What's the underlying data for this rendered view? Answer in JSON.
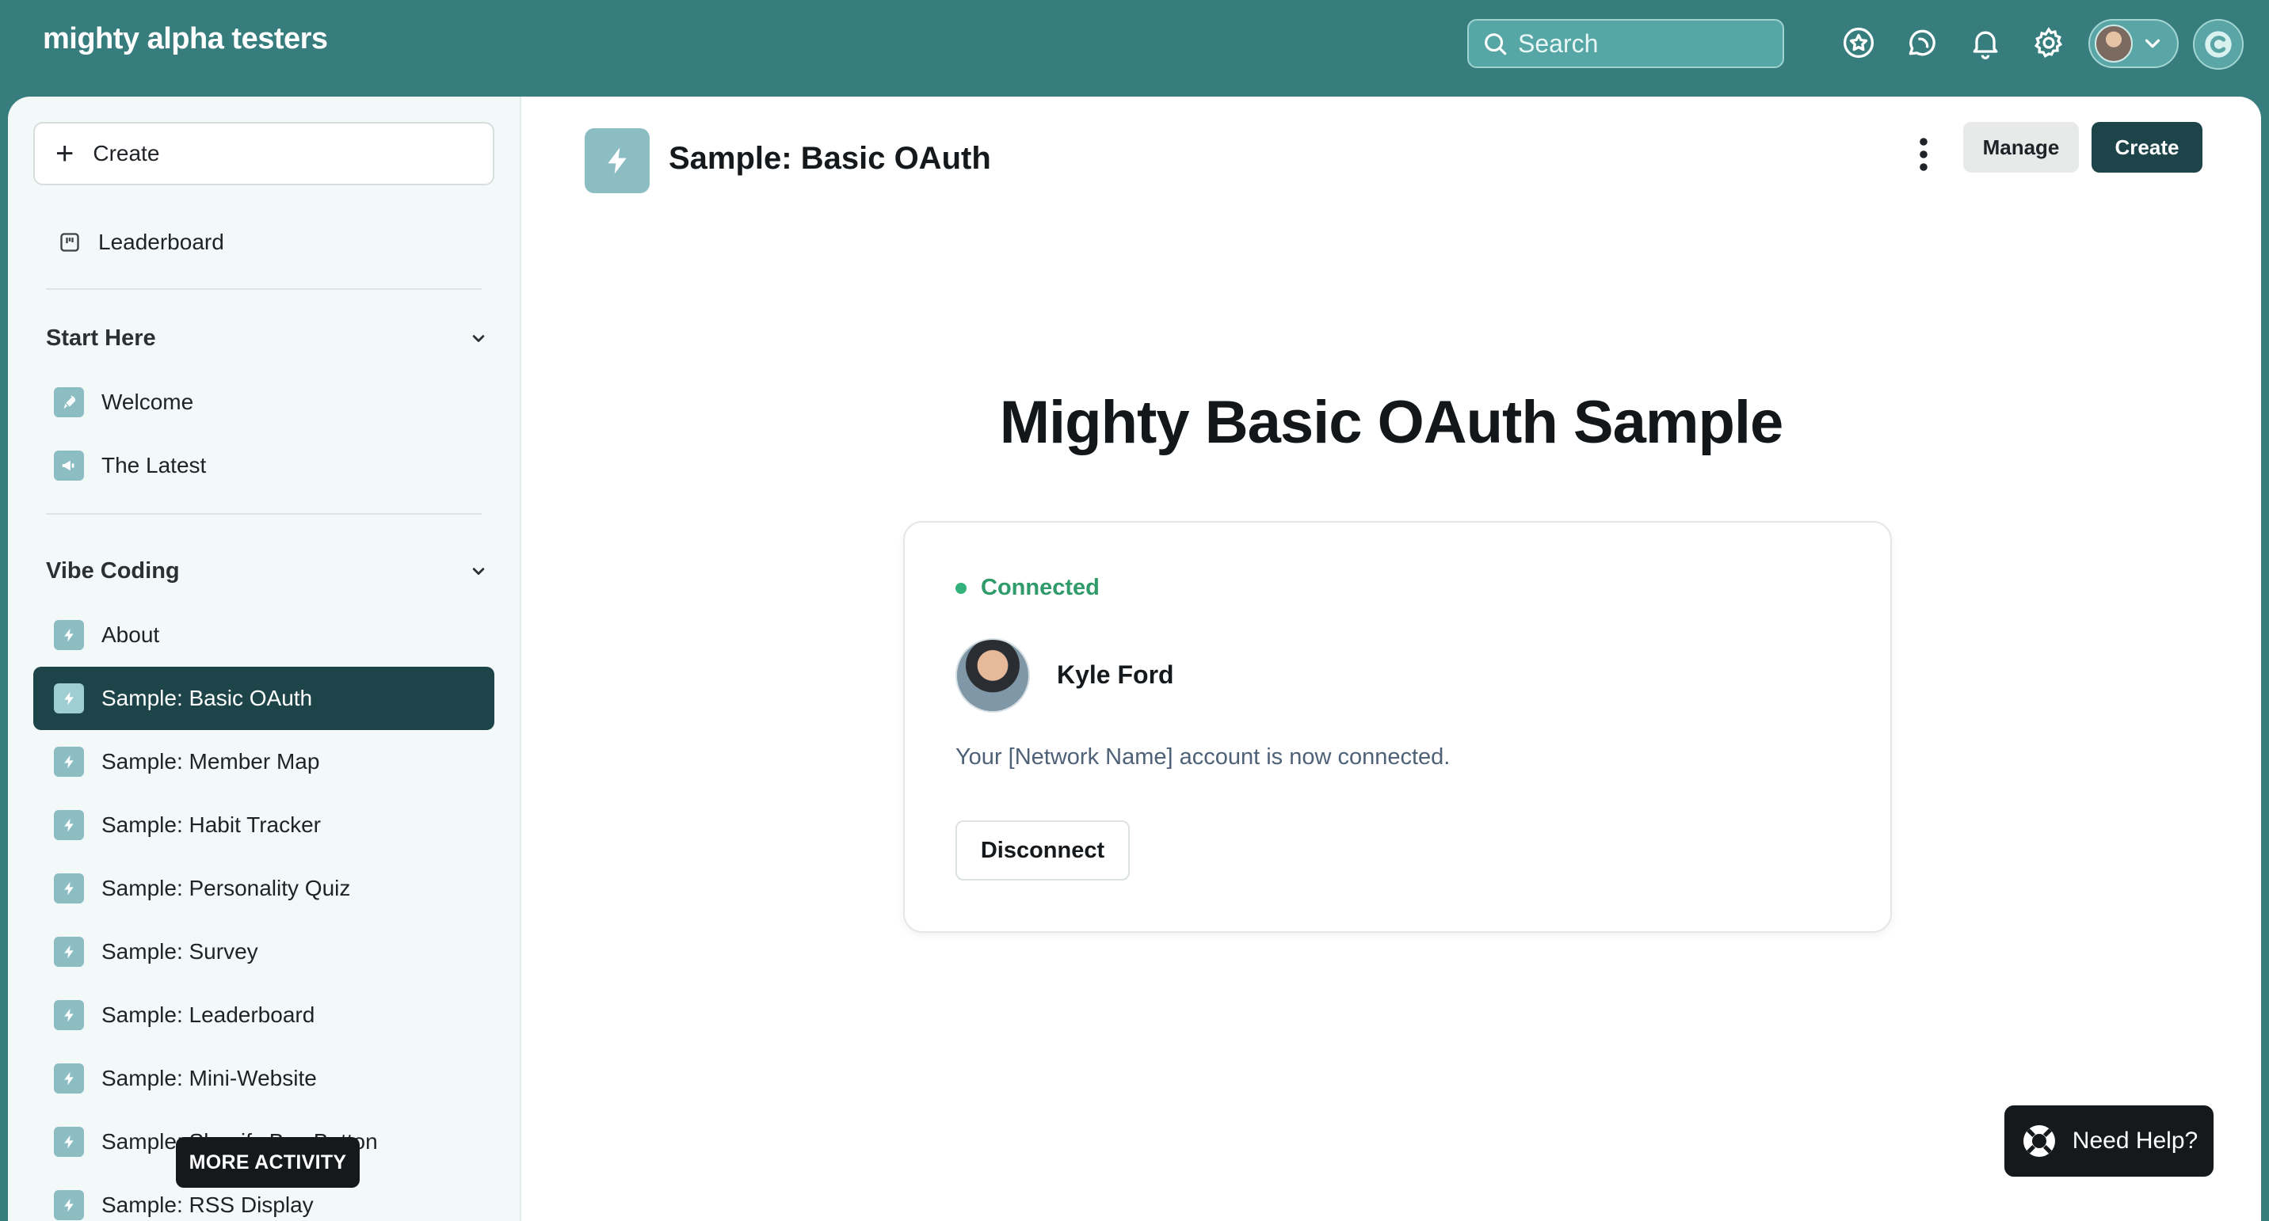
{
  "brand": {
    "name": "mighty alpha testers"
  },
  "search": {
    "placeholder": "Search"
  },
  "topbar_icons": [
    "star-badge-icon",
    "chat-icon",
    "bell-icon",
    "gear-icon"
  ],
  "sidebar": {
    "create_label": "Create",
    "leaderboard_label": "Leaderboard",
    "sections": [
      {
        "title": "Start Here",
        "items": [
          {
            "label": "Welcome",
            "icon": "rocket-icon"
          },
          {
            "label": "The Latest",
            "icon": "megaphone-icon"
          }
        ]
      },
      {
        "title": "Vibe Coding",
        "items": [
          {
            "label": "About",
            "icon": "bolt-icon"
          },
          {
            "label": "Sample: Basic OAuth",
            "icon": "bolt-icon",
            "active": true
          },
          {
            "label": "Sample: Member Map",
            "icon": "bolt-icon"
          },
          {
            "label": "Sample: Habit Tracker",
            "icon": "bolt-icon"
          },
          {
            "label": "Sample: Personality Quiz",
            "icon": "bolt-icon"
          },
          {
            "label": "Sample: Survey",
            "icon": "bolt-icon"
          },
          {
            "label": "Sample: Leaderboard",
            "icon": "bolt-icon"
          },
          {
            "label": "Sample: Mini-Website",
            "icon": "bolt-icon"
          },
          {
            "label": "Sample: Shopify Buy Button",
            "icon": "bolt-icon"
          },
          {
            "label": "Sample: RSS Display",
            "icon": "bolt-icon"
          }
        ]
      }
    ],
    "more_activity": "MORE ACTIVITY"
  },
  "page": {
    "title": "Sample: Basic OAuth",
    "manage_label": "Manage",
    "create_label": "Create"
  },
  "content": {
    "heading": "Mighty Basic OAuth Sample",
    "status": "Connected",
    "user_name": "Kyle Ford",
    "message": "Your [Network Name] account is now connected.",
    "disconnect_label": "Disconnect"
  },
  "help": {
    "label": "Need Help?"
  },
  "colors": {
    "header_bg": "#377d7d",
    "active_nav": "#1d4449",
    "accent_icon": "#8cbdc3",
    "status_green": "#2f9a6a"
  }
}
